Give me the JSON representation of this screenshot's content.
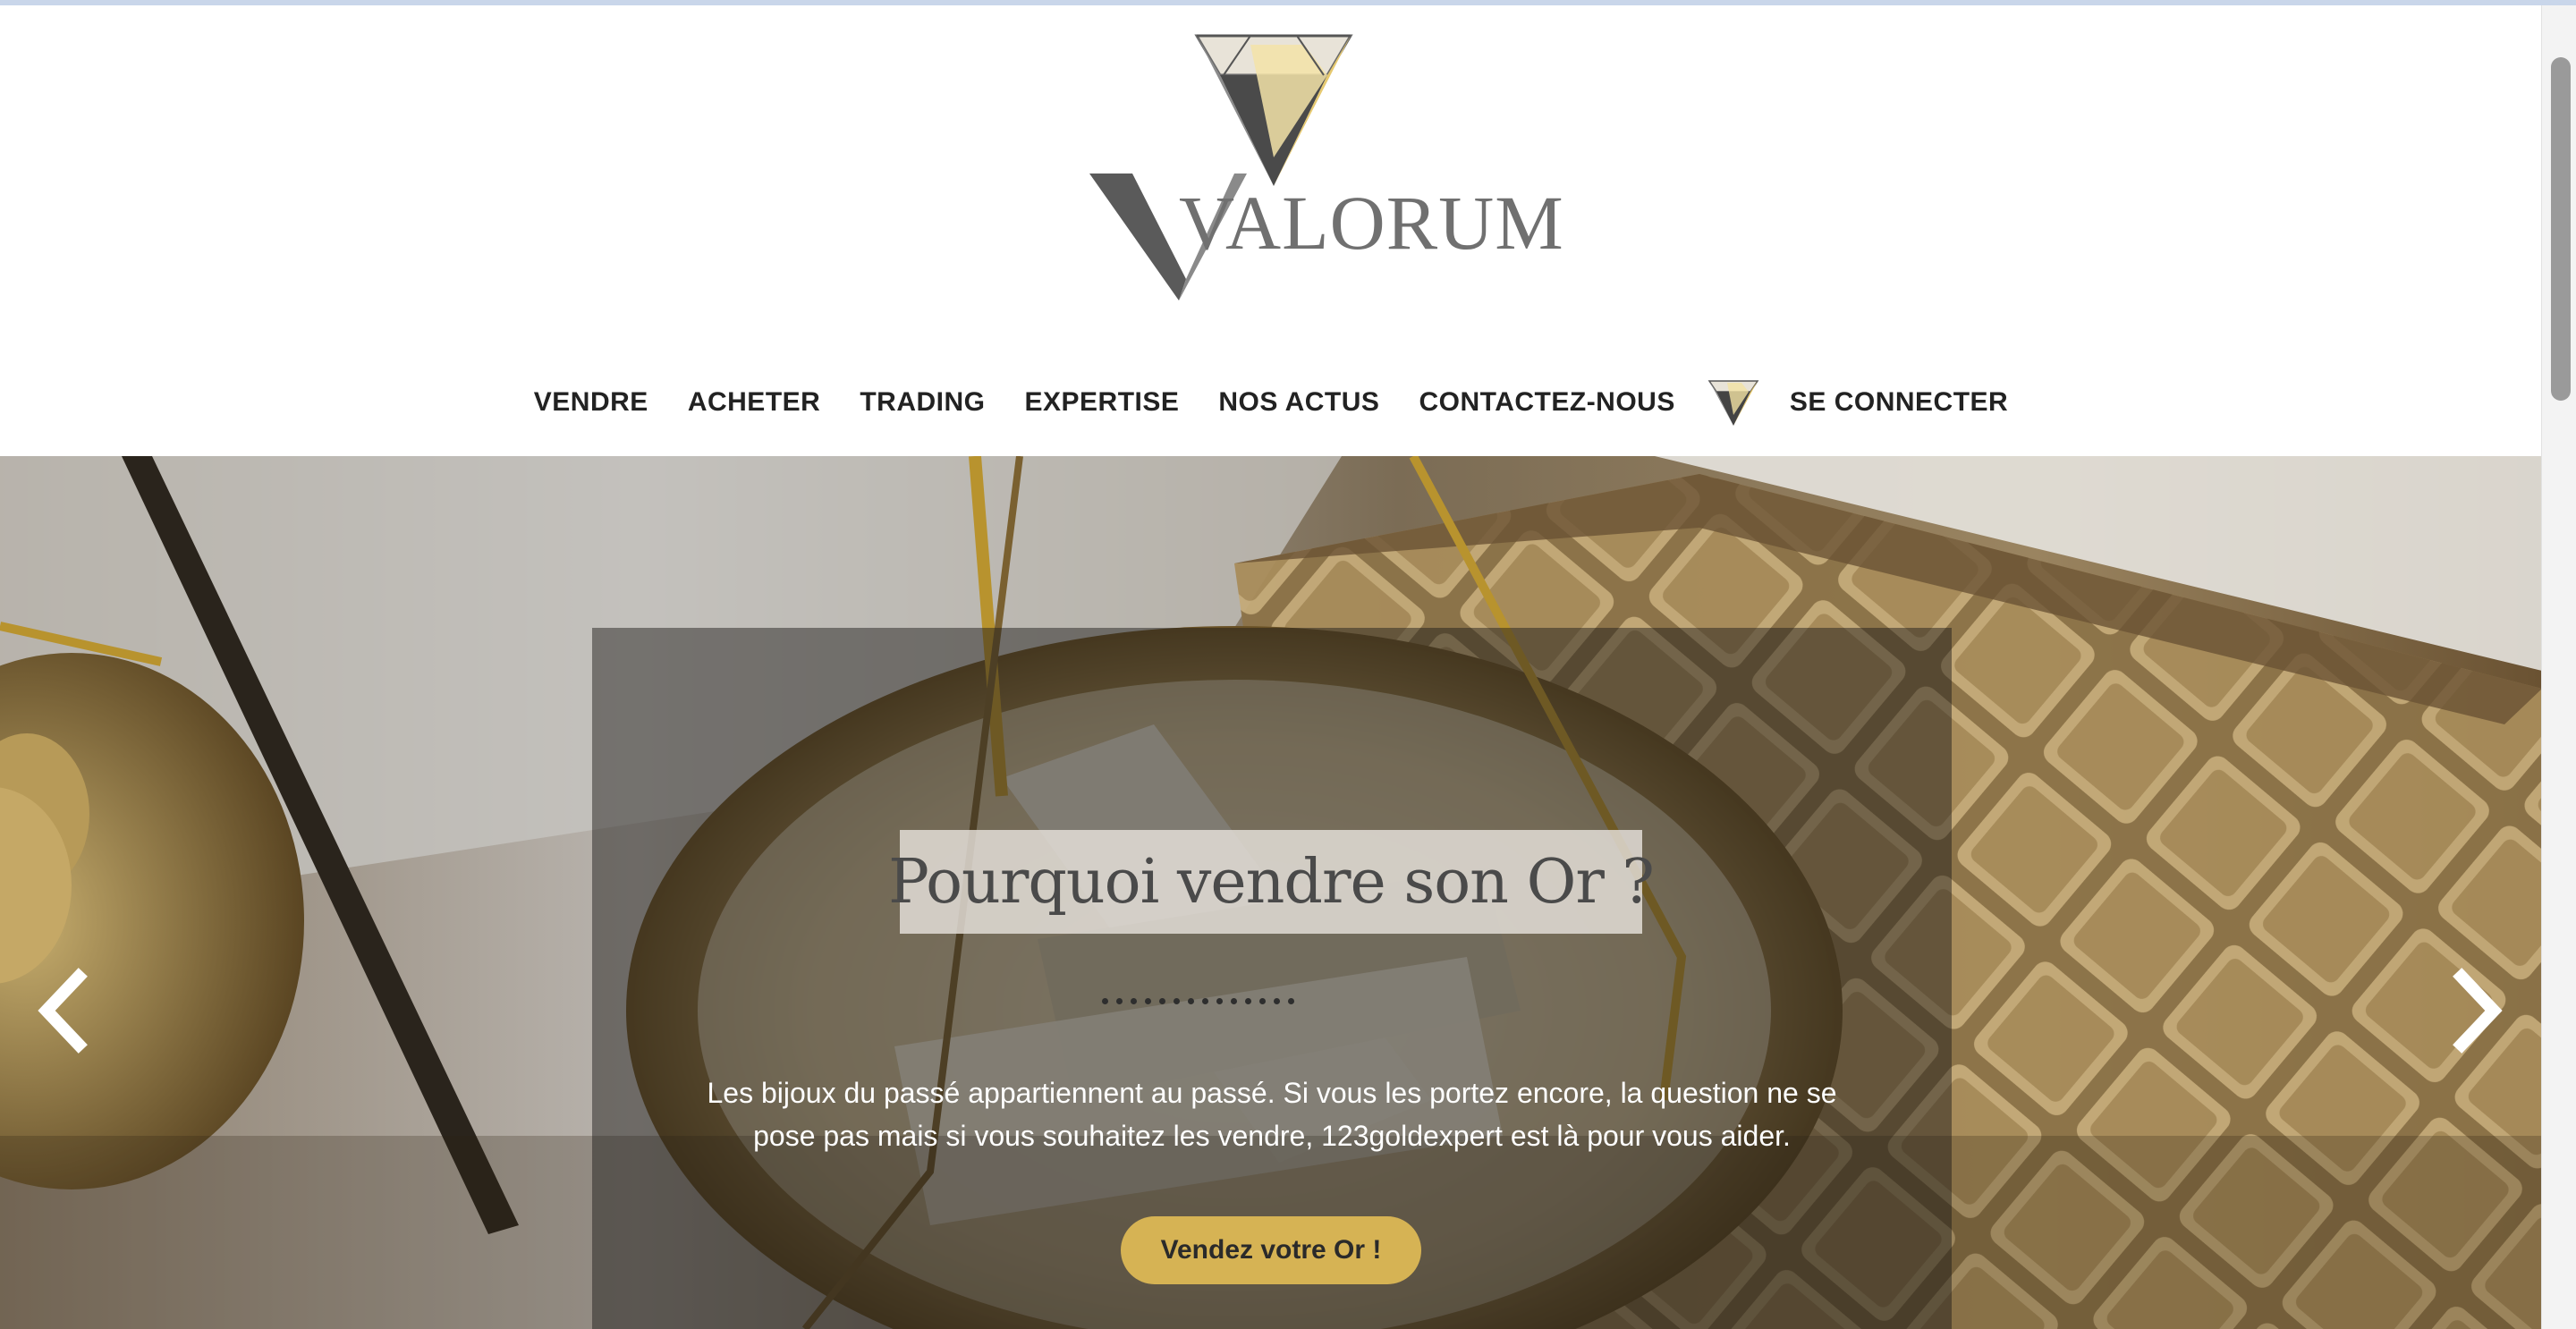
{
  "brand": {
    "name": "VALORUM",
    "logo_icon": "diamond-logo-icon"
  },
  "nav": {
    "items": [
      {
        "label": "VENDRE"
      },
      {
        "label": "ACHETER"
      },
      {
        "label": "TRADING"
      },
      {
        "label": "EXPERTISE"
      },
      {
        "label": "NOS ACTUS"
      },
      {
        "label": "CONTACTEZ-NOUS"
      }
    ],
    "account_icon": "diamond-icon",
    "login_label": "SE CONNECTER"
  },
  "hero": {
    "title": "Pourquoi vendre son Or ?",
    "text_line1": "Les bijoux du passé appartiennent au passé.  Si vous les portez encore, la question ne se",
    "text_line2": "pose pas mais si vous souhaitez les vendre, 123goldexpert est là pour vous aider.",
    "cta_label": "Vendez votre Or !",
    "prev_icon": "chevron-left-icon",
    "next_icon": "chevron-right-icon",
    "slide_count": 14
  },
  "colors": {
    "accent_gold": "#d6b354",
    "nav_text": "#222222",
    "logo_gray": "#707070"
  }
}
